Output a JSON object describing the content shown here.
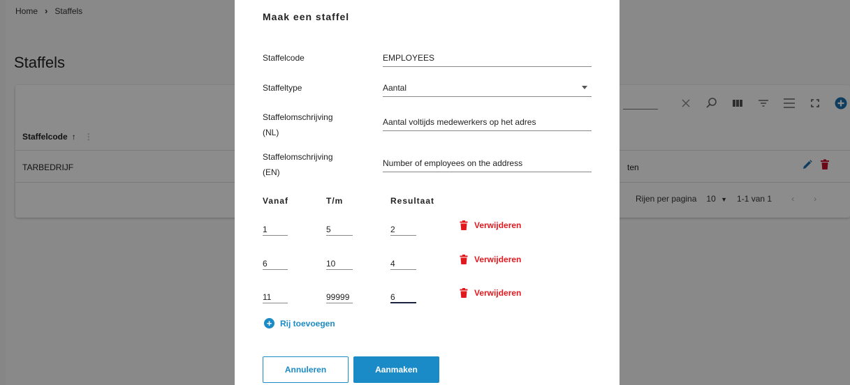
{
  "breadcrumb": {
    "home": "Home",
    "current": "Staffels"
  },
  "page": {
    "title": "Staffels"
  },
  "table": {
    "column_header": "Staffelcode",
    "rows": [
      {
        "code": "TARBEDRIJF",
        "partial_text": "ten"
      }
    ],
    "footer": {
      "rows_per_page_label": "Rijen per pagina",
      "rows_per_page_value": "10",
      "range": "1-1 van 1"
    }
  },
  "toolbar_icons": [
    "clear-icon",
    "search-icon",
    "columns-icon",
    "filter-icon",
    "density-icon",
    "fullscreen-icon",
    "add-icon"
  ],
  "dialog": {
    "title": "Maak een staffel",
    "fields": {
      "code": {
        "label": "Staffelcode",
        "value": "EMPLOYEES"
      },
      "type": {
        "label": "Staffeltype",
        "value": "Aantal"
      },
      "desc_nl": {
        "label_line1": "Staffelomschrijving",
        "label_line2": "(NL)",
        "value": "Aantal voltijds medewerkers op het adres"
      },
      "desc_en": {
        "label_line1": "Staffelomschrijving",
        "label_line2": "(EN)",
        "value": "Number of employees on the address"
      }
    },
    "columns": {
      "from": "Vanaf",
      "to": "T/m",
      "result": "Resultaat"
    },
    "rows": [
      {
        "from": "1",
        "to": "5",
        "result": "2"
      },
      {
        "from": "6",
        "to": "10",
        "result": "4"
      },
      {
        "from": "11",
        "to": "99999",
        "result": "6"
      }
    ],
    "remove_label": "Verwijderen",
    "add_row_label": "Rij toevoegen",
    "cancel_label": "Annuleren",
    "create_label": "Aanmaken"
  },
  "colors": {
    "accent": "#1a8bc7",
    "danger": "#e0191f",
    "overlay": "rgba(0,0,0,0.45)"
  }
}
